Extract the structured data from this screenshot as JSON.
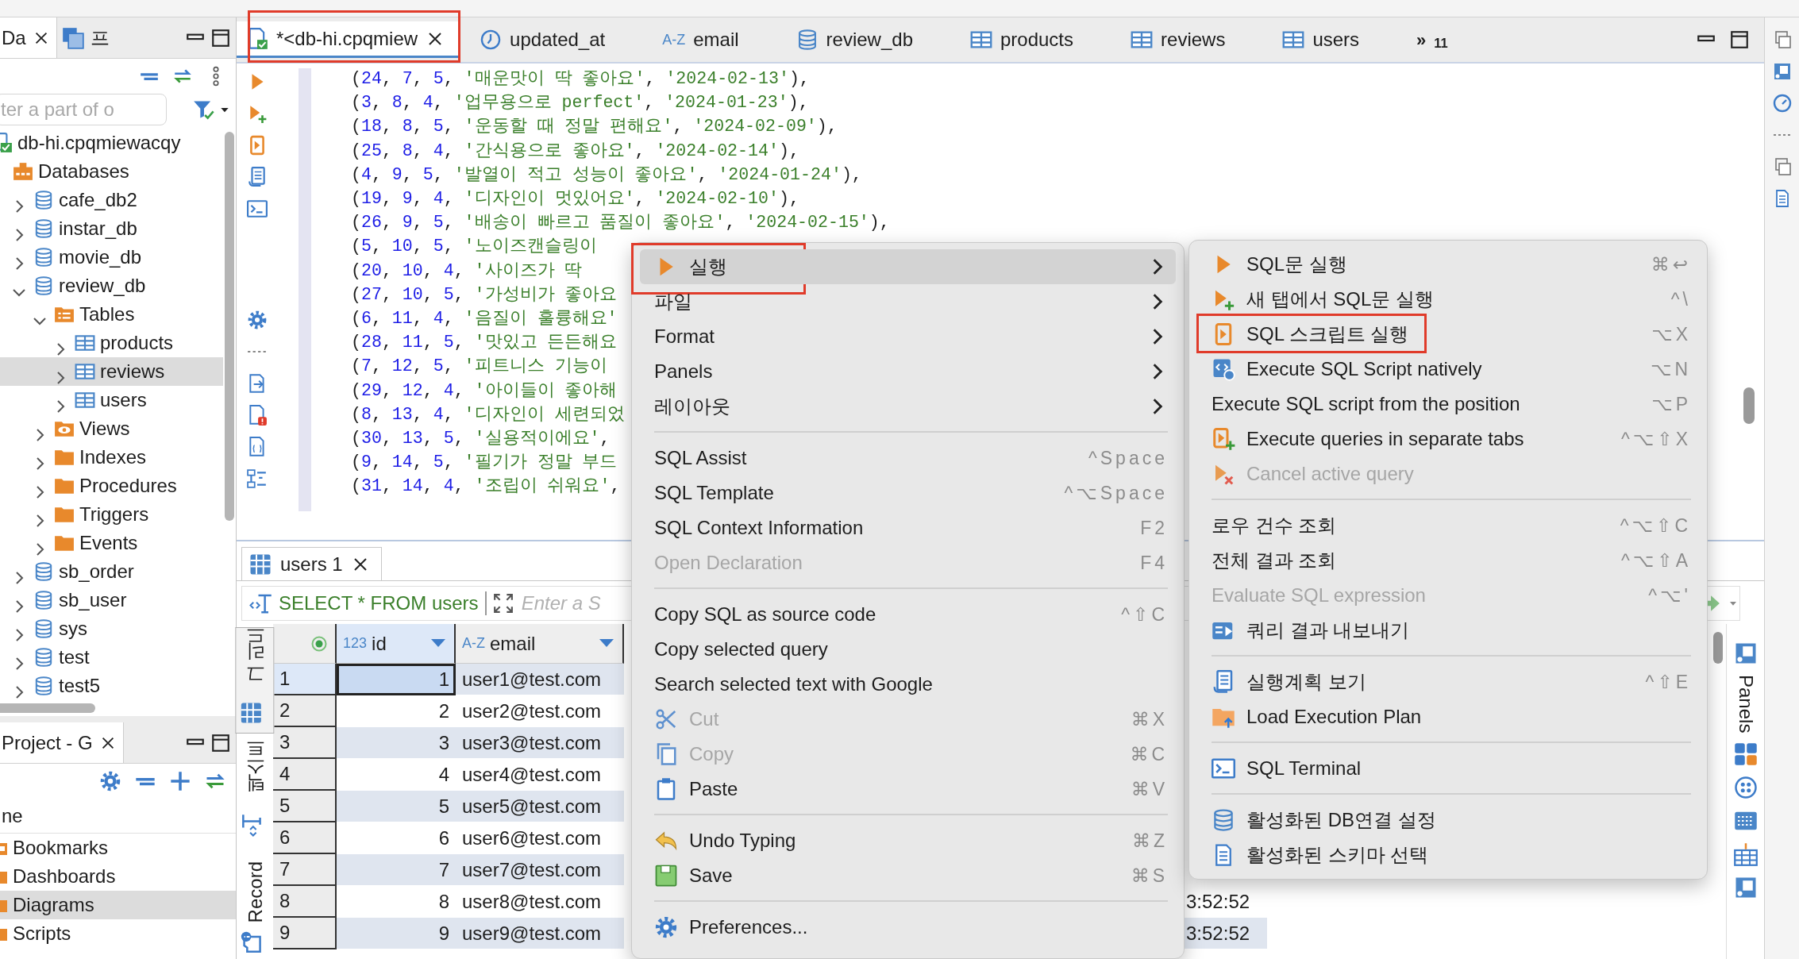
{
  "navigator": {
    "tabs": [
      {
        "label": "Da",
        "selected": true
      },
      {
        "label": "프",
        "selected": false
      }
    ],
    "filter": {
      "placeholder": "ter a part of o"
    },
    "tree": [
      {
        "label": "db-hi.cpqmiewacqy",
        "kind": "connection",
        "selected": false,
        "children": [
          {
            "label": "Databases",
            "kind": "databases",
            "selected": false,
            "children": [
              {
                "label": "cafe_db2",
                "kind": "database",
                "expanded": false,
                "selected": false
              },
              {
                "label": "instar_db",
                "kind": "database",
                "expanded": false,
                "selected": false
              },
              {
                "label": "movie_db",
                "kind": "database",
                "expanded": false,
                "selected": false
              },
              {
                "label": "review_db",
                "kind": "database",
                "expanded": true,
                "selected": false,
                "children": [
                  {
                    "label": "Tables",
                    "kind": "tables",
                    "expanded": true,
                    "selected": false,
                    "children": [
                      {
                        "label": "products",
                        "kind": "table",
                        "expanded": false,
                        "selected": false
                      },
                      {
                        "label": "reviews",
                        "kind": "table",
                        "expanded": false,
                        "selected": true
                      },
                      {
                        "label": "users",
                        "kind": "table",
                        "expanded": false,
                        "selected": false
                      }
                    ]
                  },
                  {
                    "label": "Views",
                    "kind": "views",
                    "expanded": false,
                    "selected": false
                  },
                  {
                    "label": "Indexes",
                    "kind": "folder",
                    "expanded": false,
                    "selected": false
                  },
                  {
                    "label": "Procedures",
                    "kind": "folder",
                    "expanded": false,
                    "selected": false
                  },
                  {
                    "label": "Triggers",
                    "kind": "folder",
                    "expanded": false,
                    "selected": false
                  },
                  {
                    "label": "Events",
                    "kind": "folder",
                    "expanded": false,
                    "selected": false
                  }
                ]
              },
              {
                "label": "sb_order",
                "kind": "database",
                "expanded": false,
                "selected": false
              },
              {
                "label": "sb_user",
                "kind": "database",
                "expanded": false,
                "selected": false
              },
              {
                "label": "sys",
                "kind": "database",
                "expanded": false,
                "selected": false
              },
              {
                "label": "test",
                "kind": "database",
                "expanded": false,
                "selected": false
              },
              {
                "label": "test5",
                "kind": "database",
                "expanded": false,
                "selected": false
              }
            ]
          }
        ]
      }
    ]
  },
  "project": {
    "tab": "Project - G",
    "header": "ne",
    "items": [
      {
        "label": "Bookmarks",
        "selected": false
      },
      {
        "label": "Dashboards",
        "selected": false
      },
      {
        "label": "Diagrams",
        "selected": true
      },
      {
        "label": "Scripts",
        "selected": false
      }
    ]
  },
  "editor_tabs": [
    {
      "label": "*<db-hi.cpqmiew",
      "kind": "editor",
      "selected": true,
      "annotated": true
    },
    {
      "label": "updated_at",
      "kind": "clock",
      "selected": false
    },
    {
      "label": "email",
      "kind": "text",
      "type_label": "A-Z",
      "selected": false
    },
    {
      "label": "review_db",
      "kind": "database",
      "selected": false
    },
    {
      "label": "products",
      "kind": "table",
      "selected": false
    },
    {
      "label": "reviews",
      "kind": "table",
      "selected": false
    },
    {
      "label": "users",
      "kind": "table",
      "selected": false
    },
    {
      "label": "»$_{11}$",
      "kind": "overflow",
      "selected": false
    }
  ],
  "code_lines": [
    "(24, 7, 5, '매운맛이 딱 좋아요', '2024-02-13'),",
    "(3, 8, 4, '업무용으로 perfect', '2024-01-23'),",
    "(18, 8, 5, '운동할 때 정말 편해요', '2024-02-09'),",
    "(25, 8, 4, '간식용으로 좋아요', '2024-02-14'),",
    "(4, 9, 5, '발열이 적고 성능이 좋아요', '2024-01-24'),",
    "(19, 9, 4, '디자인이 멋있어요', '2024-02-10'),",
    "(26, 9, 5, '배송이 빠르고 품질이 좋아요', '2024-02-15'),",
    "(5, 10, 5, '노이즈캔슬링이",
    "(20, 10, 4, '사이즈가 딱",
    "(27, 10, 5, '가성비가 좋아요",
    "(6, 11, 4, '음질이 훌륭해요'",
    "(28, 11, 5, '맛있고 든든해요",
    "(7, 12, 5, '피트니스 기능이",
    "(29, 12, 4, '아이들이 좋아해",
    "(8, 13, 4, '디자인이 세련되었",
    "(30, 13, 5, '실용적이에요',",
    "(9, 14, 5, '필기가 정말 부드",
    "(31, 14, 4, '조립이 쉬워요',"
  ],
  "results": {
    "tab": "users 1",
    "query": "SELECT * FROM users",
    "filter_placeholder": "Enter a S",
    "views": [
      {
        "label": "그리드",
        "selected": true
      },
      {
        "label": "텍스트",
        "selected": false
      },
      {
        "label": "Record",
        "selected": false
      }
    ],
    "columns": [
      {
        "label": "id",
        "type_label": "123",
        "selected": true
      },
      {
        "label": "email",
        "type_label": "A-Z",
        "selected": false
      }
    ],
    "rows": [
      {
        "row": "1",
        "id": "1",
        "email": "user1@test.com",
        "selected": true
      },
      {
        "row": "2",
        "id": "2",
        "email": "user2@test.com",
        "selected": false
      },
      {
        "row": "3",
        "id": "3",
        "email": "user3@test.com",
        "selected": false
      },
      {
        "row": "4",
        "id": "4",
        "email": "user4@test.com",
        "selected": false
      },
      {
        "row": "5",
        "id": "5",
        "email": "user5@test.com",
        "selected": false
      },
      {
        "row": "6",
        "id": "6",
        "email": "user6@test.com",
        "selected": false
      },
      {
        "row": "7",
        "id": "7",
        "email": "user7@test.com",
        "selected": false
      },
      {
        "row": "8",
        "id": "8",
        "email": "user8@test.com",
        "column_4": "3:52:52",
        "selected": false
      },
      {
        "row": "9",
        "id": "9",
        "email": "user9@test.com",
        "column_4": "3:52:52",
        "selected": false
      }
    ],
    "side_panel": "Panels"
  },
  "context_menu": {
    "items": [
      {
        "label": "실행",
        "submenu": true,
        "selected": true,
        "annotated": true
      },
      {
        "label": "파일",
        "submenu": true,
        "selected": false
      },
      {
        "label": "Format",
        "submenu": true,
        "selected": false
      },
      {
        "label": "Panels",
        "submenu": true,
        "selected": false
      },
      {
        "label": "레이아웃",
        "submenu": true,
        "selected": false
      },
      {
        "label": "SQL Assist",
        "shortcut": "^Space",
        "selected": false,
        "separator_before": true
      },
      {
        "label": "SQL Template",
        "shortcut": "^⌥Space",
        "selected": false
      },
      {
        "label": "SQL Context Information",
        "shortcut": "F2",
        "selected": false
      },
      {
        "label": "Open Declaration",
        "shortcut": "F4",
        "disabled": true,
        "selected": false
      },
      {
        "label": "Copy SQL as source code",
        "shortcut": "^⇧C",
        "selected": false,
        "separator_before": true
      },
      {
        "label": "Copy selected query",
        "selected": false
      },
      {
        "label": "Search selected text with Google",
        "selected": false
      },
      {
        "label": "Cut",
        "shortcut": "⌘X",
        "disabled": true,
        "selected": false
      },
      {
        "label": "Copy",
        "shortcut": "⌘C",
        "disabled": true,
        "selected": false
      },
      {
        "label": "Paste",
        "shortcut": "⌘V",
        "selected": false
      },
      {
        "label": "Undo Typing",
        "shortcut": "⌘Z",
        "selected": false,
        "separator_before": true
      },
      {
        "label": "Save",
        "shortcut": "⌘S",
        "selected": false
      },
      {
        "label": "Preferences...",
        "selected": false,
        "separator_before": true
      }
    ]
  },
  "submenu": {
    "items": [
      {
        "label": "SQL문 실행",
        "shortcut": "⌘↩",
        "selected": false
      },
      {
        "label": "새 탭에서 SQL문 실행",
        "shortcut": "^\\",
        "selected": false
      },
      {
        "label": "SQL 스크립트 실행",
        "shortcut": "⌥X",
        "selected": false,
        "annotated": true
      },
      {
        "label": "Execute SQL Script natively",
        "shortcut": "⌥N",
        "selected": false
      },
      {
        "label": "Execute SQL script from the position",
        "shortcut": "⌥P",
        "selected": false
      },
      {
        "label": "Execute queries in separate tabs",
        "shortcut": "^⌥⇧X",
        "selected": false
      },
      {
        "label": "Cancel active query",
        "disabled": true,
        "selected": false
      },
      {
        "label": "로우 건수 조회",
        "shortcut": "^⌥⇧C",
        "selected": false,
        "separator_before": true
      },
      {
        "label": "전체 결과 조회",
        "shortcut": "^⌥⇧A",
        "selected": false
      },
      {
        "label": "Evaluate SQL expression",
        "shortcut": "^⌥'",
        "disabled": true,
        "selected": false
      },
      {
        "label": "쿼리 결과 내보내기",
        "selected": false
      },
      {
        "label": "실행계획 보기",
        "shortcut": "^⇧E",
        "selected": false,
        "separator_before": true
      },
      {
        "label": "Load Execution Plan",
        "selected": false
      },
      {
        "label": "SQL Terminal",
        "selected": false,
        "separator_before": true
      },
      {
        "label": "활성화된 DB연결 설정",
        "selected": false,
        "separator_before": true
      },
      {
        "label": "활성화된 스키마 선택",
        "selected": false
      }
    ]
  }
}
